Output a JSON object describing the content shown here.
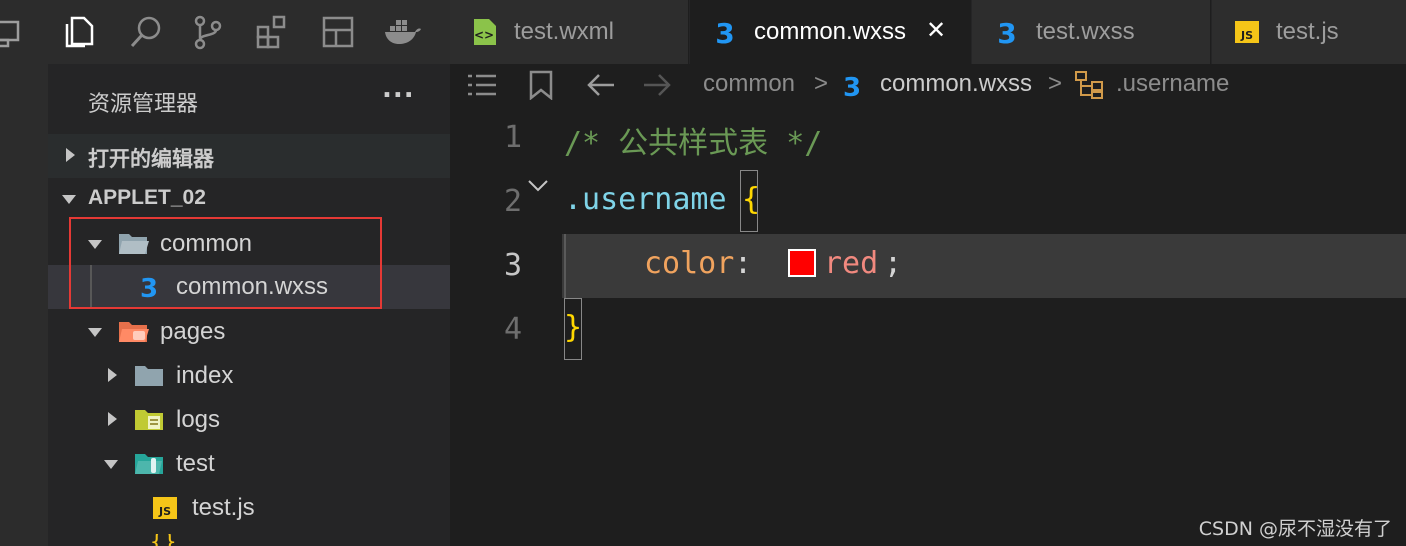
{
  "explorer": {
    "title": "资源管理器",
    "more": "...",
    "open_editors": "打开的编辑器",
    "project": "APPLET_02",
    "tree": [
      {
        "label": "common"
      },
      {
        "label": "common.wxss"
      },
      {
        "label": "pages"
      },
      {
        "label": "index"
      },
      {
        "label": "logs"
      },
      {
        "label": "test"
      },
      {
        "label": "test.js"
      }
    ]
  },
  "tabs": [
    {
      "label": "test.wxml"
    },
    {
      "label": "common.wxss",
      "close": "✕"
    },
    {
      "label": "test.wxss"
    },
    {
      "label": "test.js",
      "icon_text": "JS"
    }
  ],
  "breadcrumb": {
    "folder": "common",
    "file": "common.wxss",
    "symbol": ".username",
    "sep": ">"
  },
  "editor": {
    "lines": [
      {
        "num": "1",
        "text": "/* 公共样式表 */"
      },
      {
        "num": "2",
        "selector": ".username",
        "brace_open": "{"
      },
      {
        "num": "3",
        "prop": "color",
        "colon": ":",
        "value": "red",
        "semi": ";"
      },
      {
        "num": "4",
        "brace_close": "}"
      }
    ],
    "swatch_color": "#ff0000"
  },
  "watermark": "CSDN @尿不湿没有了",
  "colors": {
    "accent_blue": "#42a5f5",
    "css_icon": "#2196f3",
    "highlight_red": "#e53935",
    "comment": "#6a9955",
    "selector": "#7fd4e8",
    "property": "#f0a35e",
    "value": "#f1897f",
    "brace": "#ffd700"
  }
}
